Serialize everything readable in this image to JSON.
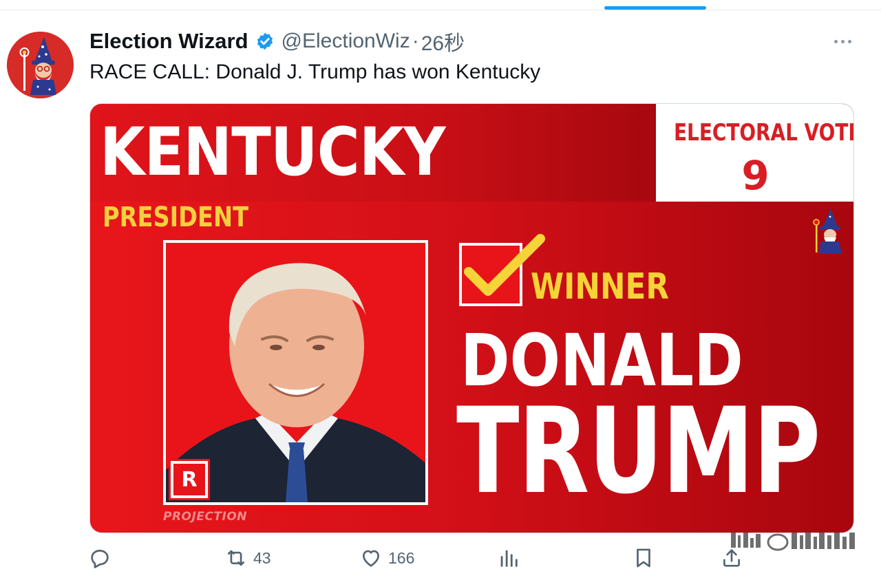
{
  "tweet": {
    "author": {
      "display_name": "Election Wizard",
      "handle": "@ElectionWiz",
      "verified": true,
      "avatar_icon": "wizard-avatar-icon"
    },
    "separator": "·",
    "timestamp": "26秒",
    "text": "RACE CALL: Donald J. Trump has won Kentucky"
  },
  "card": {
    "state": "KENTUCKY",
    "electoral_votes_label": "ELECTORAL VOTES",
    "electoral_votes": "9",
    "office": "PRESIDENT",
    "party_badge": "R",
    "winner_label": "WINNER",
    "first_name": "DONALD",
    "last_name": "TRUMP",
    "footer": "PROJECTION",
    "colors": {
      "primary_red": "#e8141a",
      "dark_red": "#a8060e",
      "accent_yellow": "#f6d437",
      "white": "#ffffff"
    }
  },
  "actions": {
    "reply": {
      "icon": "reply-icon",
      "count": ""
    },
    "retweet": {
      "icon": "retweet-icon",
      "count": "43"
    },
    "like": {
      "icon": "heart-icon",
      "count": "166"
    },
    "views": {
      "icon": "views-icon",
      "count": ""
    },
    "bookmark": {
      "icon": "bookmark-icon",
      "count": ""
    },
    "share": {
      "icon": "share-icon",
      "count": ""
    }
  },
  "colors": {
    "accent_blue": "#1d9bf0",
    "text_secondary": "#536471",
    "text_primary": "#0f1419"
  }
}
